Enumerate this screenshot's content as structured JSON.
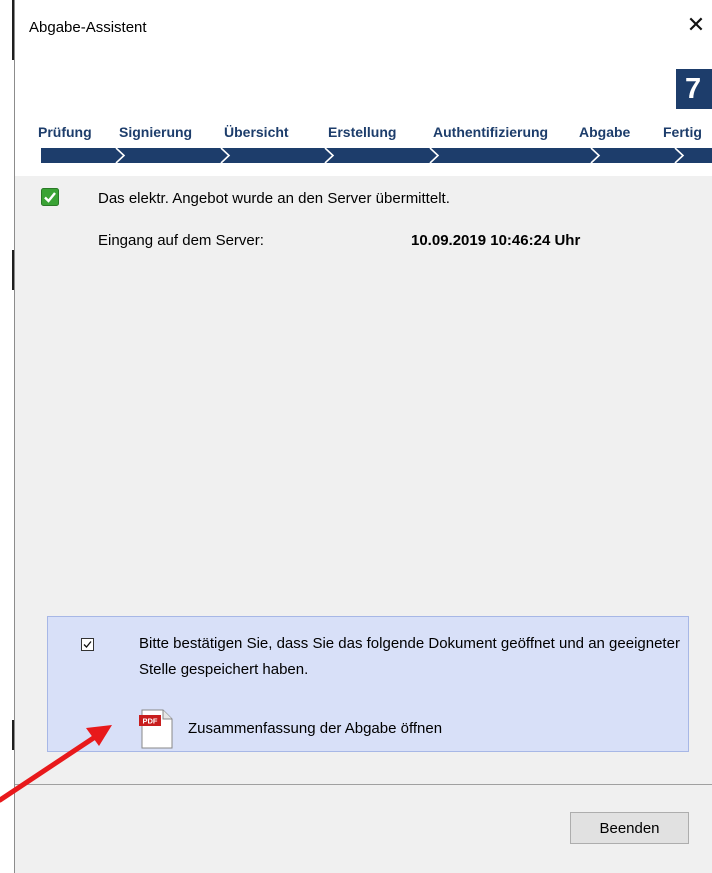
{
  "window": {
    "title": "Abgabe-Assistent",
    "close_icon": "close-icon",
    "step_number": "7"
  },
  "steps": [
    {
      "label": "Prüfung"
    },
    {
      "label": "Signierung"
    },
    {
      "label": "Übersicht"
    },
    {
      "label": "Erstellung"
    },
    {
      "label": "Authentifizierung"
    },
    {
      "label": "Abgabe"
    },
    {
      "label": "Fertig"
    }
  ],
  "status": {
    "icon": "green-check-icon",
    "message": "Das elektr. Angebot wurde an den Server übermittelt.",
    "received_label": "Eingang auf dem Server:",
    "received_value": "10.09.2019 10:46:24 Uhr"
  },
  "confirmation": {
    "checked": true,
    "text": "Bitte bestätigen Sie, dass Sie das folgende Dokument geöffnet und an geeigneter Stelle gespeichert haben.",
    "pdf_icon_label": "PDF",
    "pdf_link_label": "Zusammenfassung der Abgabe öffnen"
  },
  "footer": {
    "finish_label": "Beenden"
  },
  "colors": {
    "accent": "#1d3d6b",
    "confirm_bg": "#d8e0f8",
    "arrow": "#e8191b",
    "check_green": "#3aa335"
  }
}
